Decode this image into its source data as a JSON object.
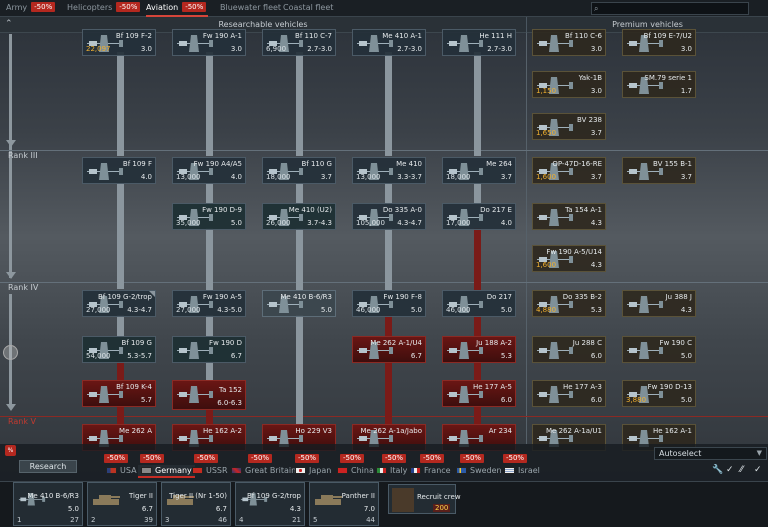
{
  "top_tabs": [
    {
      "label": "Army",
      "discount": "-50%"
    },
    {
      "label": "Helicopters",
      "discount": "-50%"
    },
    {
      "label": "Aviation",
      "discount": "-50%",
      "active": true
    },
    {
      "label": "Bluewater fleet",
      "discount": ""
    },
    {
      "label": "Coastal fleet",
      "discount": ""
    }
  ],
  "search": {
    "placeholder": ""
  },
  "header": {
    "researchable": "Researchable vehicles",
    "premium": "Premium vehicles"
  },
  "ranks": {
    "r3": "Rank III",
    "r4": "Rank IV",
    "r5": "Rank V"
  },
  "tree": {
    "row0": [
      {
        "name": "Bf 109 F-2",
        "rp": "22,097",
        "br": "3.0"
      },
      {
        "name": "Fw 190 A-1",
        "rp": "",
        "br": "3.0"
      },
      {
        "name": "Bf 110 C-7",
        "rp": "6,900",
        "br": "2.7-3.0"
      },
      {
        "name": "Me 410 A-1",
        "rp": "",
        "br": "2.7-3.0"
      },
      {
        "name": "He 111 H",
        "rp": "",
        "br": "2.7-3.0"
      }
    ],
    "row1": [
      {
        "name": "Bf 109 F",
        "rp": "",
        "br": "4.0"
      },
      {
        "name": "Fw 190 A4/A5",
        "rp": "13,000",
        "br": "4.0"
      },
      {
        "name": "Bf 110 G",
        "rp": "18,000",
        "br": "3.7"
      },
      {
        "name": "Me 410",
        "rp": "13,000",
        "br": "3.3-3.7"
      },
      {
        "name": "Me 264",
        "rp": "18,000",
        "br": "3.7"
      }
    ],
    "row2": [
      {
        "name": "Fw 190 D-9",
        "rp": "35,000",
        "br": "5.0"
      },
      {
        "name": "Me 410 (U2)",
        "rp": "26,000",
        "br": "3.7-4.3"
      },
      {
        "name": "Do 335 A-0",
        "rp": "105,000",
        "br": "4.3-4.7"
      },
      {
        "name": "Do 217 E",
        "rp": "17,000",
        "br": "4.0"
      }
    ],
    "row3": [
      {
        "name": "Bf 109 G-2/trop",
        "rp": "27,000",
        "br": "4.3-4.7"
      },
      {
        "name": "Fw 190 A-5",
        "rp": "27,000",
        "br": "4.3-5.0"
      },
      {
        "name": "Me 410 B-6/R3",
        "rp": "",
        "br": "5.0"
      },
      {
        "name": "Fw 190 F-8",
        "rp": "46,000",
        "br": "5.0"
      },
      {
        "name": "Do 217",
        "rp": "46,000",
        "br": "5.0"
      }
    ],
    "row4": [
      {
        "name": "Bf 109 G",
        "rp": "54,000",
        "br": "5.3-5.7"
      },
      {
        "name": "Fw 190 D",
        "rp": "",
        "br": "6.7"
      },
      {
        "name": "Me 262 A-1/U4",
        "rp": "",
        "br": "6.7"
      },
      {
        "name": "Ju 188 A-2",
        "rp": "",
        "br": "5.3"
      }
    ],
    "row5": [
      {
        "name": "Bf 109 K-4",
        "rp": "",
        "br": "5.7"
      },
      {
        "name": "Ta 152",
        "rp": "",
        "br": "6.0-6.3"
      },
      {
        "name": "He 177 A-5",
        "rp": "",
        "br": "6.0"
      }
    ],
    "row6": [
      {
        "name": "Me 262 A",
        "rp": "",
        "br": ""
      },
      {
        "name": "He 162 A-2",
        "rp": "",
        "br": ""
      },
      {
        "name": "Ho 229 V3",
        "rp": "",
        "br": ""
      },
      {
        "name": "Me 262 A-1a/Jabo",
        "rp": "",
        "br": ""
      },
      {
        "name": "Ar 234",
        "rp": "",
        "br": ""
      }
    ]
  },
  "premium": [
    {
      "name": "Bf 110 C-6",
      "rp": "",
      "br": "3.0"
    },
    {
      "name": "Bf 109 E-7/U2",
      "rp": "",
      "br": "3.0"
    },
    {
      "name": "Yak-1B",
      "rp": "1,150",
      "br": "3.0"
    },
    {
      "name": "SM.79 serie 1",
      "rp": "",
      "br": "1.7"
    },
    {
      "name": "BV 238",
      "rp": "1,650",
      "br": "3.7"
    },
    {
      "name": "OP-47D-16-RE",
      "rp": "1,600",
      "br": "3.7"
    },
    {
      "name": "BV 155 B-1",
      "rp": "",
      "br": "3.7"
    },
    {
      "name": "Ta 154 A-1",
      "rp": "",
      "br": "4.3"
    },
    {
      "name": "Fw 190 A-5/U14",
      "rp": "1,600",
      "br": "4.3"
    },
    {
      "name": "Do 335 B-2",
      "rp": "4,880",
      "br": "5.3"
    },
    {
      "name": "Ju 388 J",
      "rp": "",
      "br": "4.3"
    },
    {
      "name": "Ju 288 C",
      "rp": "",
      "br": "6.0"
    },
    {
      "name": "Fw 190 C",
      "rp": "",
      "br": "5.0"
    },
    {
      "name": "He 177 A-3",
      "rp": "",
      "br": "6.0"
    },
    {
      "name": "Fw 190 D-13",
      "rp": "3,880",
      "br": "5.0"
    },
    {
      "name": "Me 262 A-1a/U1",
      "rp": "",
      "br": ""
    },
    {
      "name": "He 162 A-1",
      "rp": "",
      "br": ""
    }
  ],
  "bottom": {
    "hv": "%",
    "research": "Research",
    "autoselect": "Autoselect",
    "nations": [
      {
        "name": "USA",
        "discount": "-50%"
      },
      {
        "name": "Germany",
        "discount": "-50%",
        "selected": true
      },
      {
        "name": "USSR",
        "discount": "-50%"
      },
      {
        "name": "Great Britain",
        "discount": "-50%"
      },
      {
        "name": "Japan",
        "discount": "-50%"
      },
      {
        "name": "China",
        "discount": "-50%"
      },
      {
        "name": "Italy",
        "discount": "-50%"
      },
      {
        "name": "France",
        "discount": "-50%"
      },
      {
        "name": "Sweden",
        "discount": "-50%"
      },
      {
        "name": "Israel",
        "discount": "-50%"
      }
    ]
  },
  "lineup": [
    {
      "name": "Me 410 B-6/R3",
      "br": "5.0",
      "num": "1",
      "count": "27"
    },
    {
      "name": "Tiger II",
      "br": "6.7",
      "num": "2",
      "count": "39"
    },
    {
      "name": "Tiger II (Nr 1-50)",
      "br": "6.7",
      "num": "3",
      "count": "46"
    },
    {
      "name": "Bf 109 G-2/trop",
      "br": "4.3",
      "num": "4",
      "count": "21"
    },
    {
      "name": "Panther II",
      "br": "7.0",
      "num": "5",
      "count": "44"
    }
  ],
  "crew": {
    "label": "Recruit crew",
    "cost": "200"
  },
  "colors": {
    "accent_red": "#b4281f",
    "gold": "#f0b030",
    "tree_line": "#8b969e",
    "locked_red": "#7a1b18"
  }
}
